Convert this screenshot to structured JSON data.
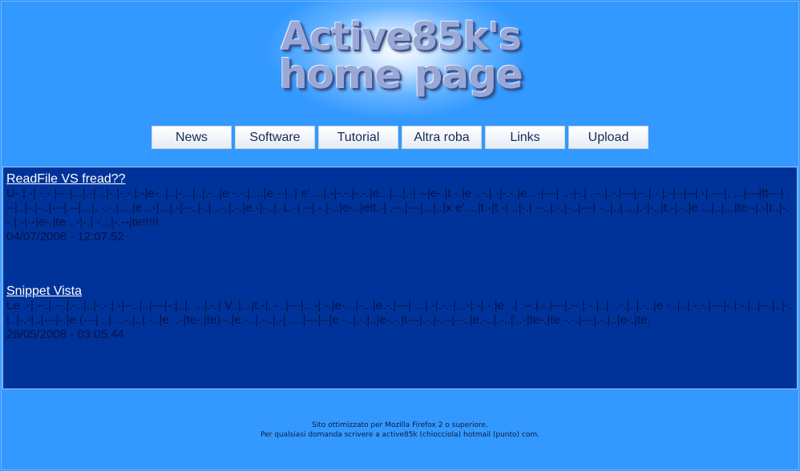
{
  "header": {
    "logo_line1": "Active85k's",
    "logo_line2": "home page"
  },
  "nav": {
    "items": [
      {
        "label": "News"
      },
      {
        "label": "Software"
      },
      {
        "label": "Tutorial"
      },
      {
        "label": "Altra roba"
      },
      {
        "label": "Links"
      },
      {
        "label": "Upload"
      }
    ]
  },
  "posts": [
    {
      "title": "ReadFile VS fread??",
      "body": "U-.|.-| -.-.|---|...|.-| ..|-.|-.-.|.-|e-..|..|-...|..|.-..|e -.-.|....|e --|..| e' ...|.-|-.-.|-.-.|e...|...|.-| --|e-.|t.-.|e ..-.|.-|-.-.|e...-|---| ..-|-.| .--.|.-.|---|--.|.-.|.-|--|--|.-|.---|, ...|---|tt---| .--|..|-.|-..|---|.--|...|, -.-.|....|e ..-|...|.-|--..|-.| ..-.|.-.|e.-|-..|. L.-| --|.-.|-..|e-..|ett.-| .--.|---|...|..|x e' ...|t.-|t.-| ..|-.| --..|.-.|-..|---| -..|..| ...|.-|-..|t.-|.-.|e ...|..|...|te--|.-|t..|-.-.|.-|--|e-.|te ..-|-.| -...|-.--|te!!!!!",
      "date": "04/07/2008 - 12:07.52"
    },
    {
      "title": "Snippet Vista",
      "body": "Le .-|.--.|.--.|.-..|..|-.-.|.-|--..|..|---|-.|..|, ...|.-.| V..|...|t.-|, -..|---|...-|.-.|e-...|-...|e.-.|---| ...|.-|.-.-|...-|.-|.-.|e ..| .--.|.-.|---|.--.|.-.|..| ..-.|..|.-..|e -..|..| -.-.|---|-.|.-.|..|--.|..|-.|..|-.-|..|---|-.|e (---| ..| ...-.|..|.-..|e ..-|te-.|te) -.|e.-..|.-..|.-| ....|---|--|e -..|.-.|..|e-.-.|t---|.-.|-.--|--..|e.-..|.-..|'..-|te-.|te -.-.|---|.-.|..|e-.|te.",
      "date": "28/05/2008 - 03:05.44"
    }
  ],
  "footer": {
    "line1": "Sito ottimizzato per Mozilla Firefox 2 o superiore.",
    "line2": "Per qualsiasi domanda scrivere a active85k (chiocciola) hotmail (punto) com."
  }
}
